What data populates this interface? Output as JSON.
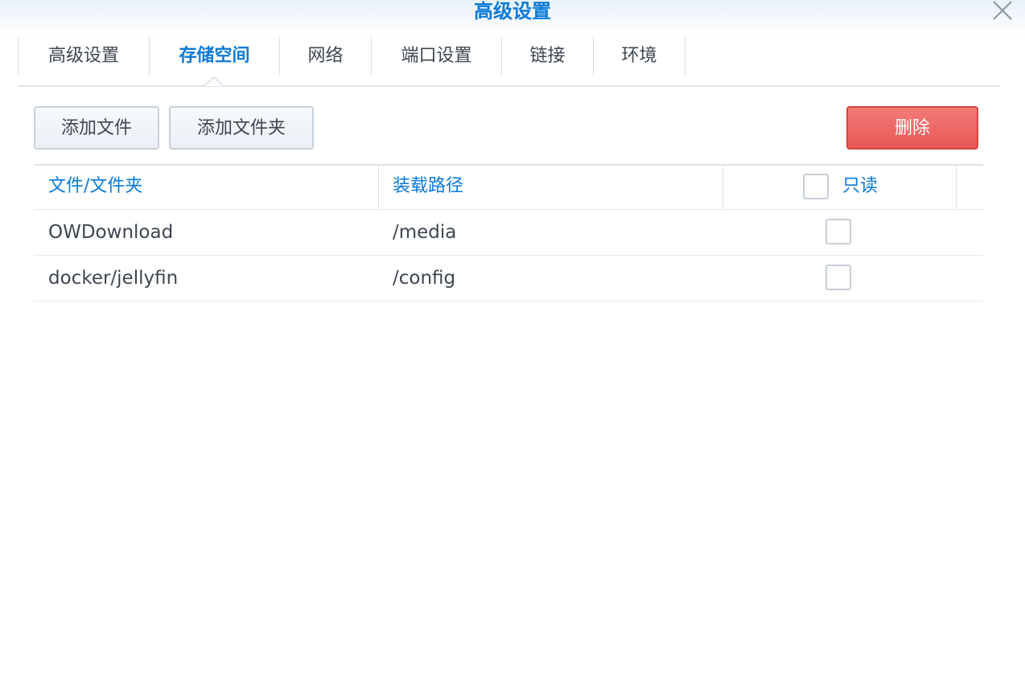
{
  "dialog": {
    "title": "高级设置",
    "close_icon": "close-icon"
  },
  "tabs": [
    {
      "label": "高级设置",
      "active": false
    },
    {
      "label": "存储空间",
      "active": true
    },
    {
      "label": "网络",
      "active": false
    },
    {
      "label": "端口设置",
      "active": false
    },
    {
      "label": "链接",
      "active": false
    },
    {
      "label": "环境",
      "active": false
    }
  ],
  "toolbar": {
    "add_file_label": "添加文件",
    "add_folder_label": "添加文件夹",
    "delete_label": "删除"
  },
  "table": {
    "columns": {
      "folder": "文件/文件夹",
      "mount_path": "装载路径",
      "readonly": "只读"
    },
    "rows": [
      {
        "folder": "OWDownload",
        "mount_path": "/media",
        "readonly": false
      },
      {
        "folder": "docker/jellyfin",
        "mount_path": "/config",
        "readonly": false
      }
    ]
  },
  "colors": {
    "accent": "#0a7ad8",
    "danger": "#e85855",
    "text": "#3d4650",
    "border": "#c6d0da"
  }
}
